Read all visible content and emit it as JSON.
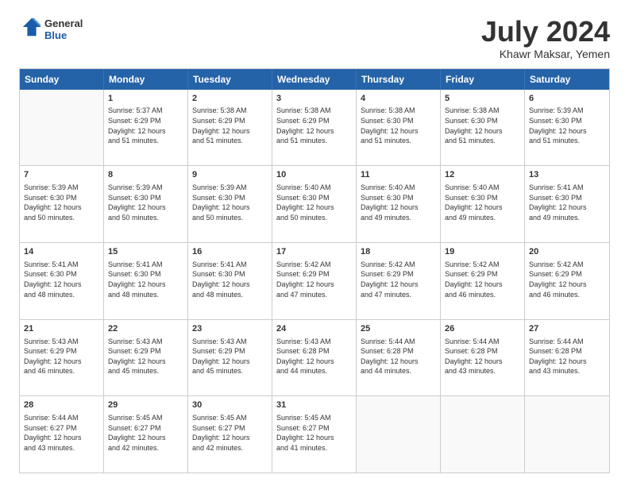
{
  "header": {
    "logo_general": "General",
    "logo_blue": "Blue",
    "month_title": "July 2024",
    "subtitle": "Khawr Maksar, Yemen"
  },
  "weekdays": [
    "Sunday",
    "Monday",
    "Tuesday",
    "Wednesday",
    "Thursday",
    "Friday",
    "Saturday"
  ],
  "rows": [
    [
      {
        "day": "",
        "info": ""
      },
      {
        "day": "1",
        "info": "Sunrise: 5:37 AM\nSunset: 6:29 PM\nDaylight: 12 hours\nand 51 minutes."
      },
      {
        "day": "2",
        "info": "Sunrise: 5:38 AM\nSunset: 6:29 PM\nDaylight: 12 hours\nand 51 minutes."
      },
      {
        "day": "3",
        "info": "Sunrise: 5:38 AM\nSunset: 6:29 PM\nDaylight: 12 hours\nand 51 minutes."
      },
      {
        "day": "4",
        "info": "Sunrise: 5:38 AM\nSunset: 6:30 PM\nDaylight: 12 hours\nand 51 minutes."
      },
      {
        "day": "5",
        "info": "Sunrise: 5:38 AM\nSunset: 6:30 PM\nDaylight: 12 hours\nand 51 minutes."
      },
      {
        "day": "6",
        "info": "Sunrise: 5:39 AM\nSunset: 6:30 PM\nDaylight: 12 hours\nand 51 minutes."
      }
    ],
    [
      {
        "day": "7",
        "info": "Sunrise: 5:39 AM\nSunset: 6:30 PM\nDaylight: 12 hours\nand 50 minutes."
      },
      {
        "day": "8",
        "info": "Sunrise: 5:39 AM\nSunset: 6:30 PM\nDaylight: 12 hours\nand 50 minutes."
      },
      {
        "day": "9",
        "info": "Sunrise: 5:39 AM\nSunset: 6:30 PM\nDaylight: 12 hours\nand 50 minutes."
      },
      {
        "day": "10",
        "info": "Sunrise: 5:40 AM\nSunset: 6:30 PM\nDaylight: 12 hours\nand 50 minutes."
      },
      {
        "day": "11",
        "info": "Sunrise: 5:40 AM\nSunset: 6:30 PM\nDaylight: 12 hours\nand 49 minutes."
      },
      {
        "day": "12",
        "info": "Sunrise: 5:40 AM\nSunset: 6:30 PM\nDaylight: 12 hours\nand 49 minutes."
      },
      {
        "day": "13",
        "info": "Sunrise: 5:41 AM\nSunset: 6:30 PM\nDaylight: 12 hours\nand 49 minutes."
      }
    ],
    [
      {
        "day": "14",
        "info": "Sunrise: 5:41 AM\nSunset: 6:30 PM\nDaylight: 12 hours\nand 48 minutes."
      },
      {
        "day": "15",
        "info": "Sunrise: 5:41 AM\nSunset: 6:30 PM\nDaylight: 12 hours\nand 48 minutes."
      },
      {
        "day": "16",
        "info": "Sunrise: 5:41 AM\nSunset: 6:30 PM\nDaylight: 12 hours\nand 48 minutes."
      },
      {
        "day": "17",
        "info": "Sunrise: 5:42 AM\nSunset: 6:29 PM\nDaylight: 12 hours\nand 47 minutes."
      },
      {
        "day": "18",
        "info": "Sunrise: 5:42 AM\nSunset: 6:29 PM\nDaylight: 12 hours\nand 47 minutes."
      },
      {
        "day": "19",
        "info": "Sunrise: 5:42 AM\nSunset: 6:29 PM\nDaylight: 12 hours\nand 46 minutes."
      },
      {
        "day": "20",
        "info": "Sunrise: 5:42 AM\nSunset: 6:29 PM\nDaylight: 12 hours\nand 46 minutes."
      }
    ],
    [
      {
        "day": "21",
        "info": "Sunrise: 5:43 AM\nSunset: 6:29 PM\nDaylight: 12 hours\nand 46 minutes."
      },
      {
        "day": "22",
        "info": "Sunrise: 5:43 AM\nSunset: 6:29 PM\nDaylight: 12 hours\nand 45 minutes."
      },
      {
        "day": "23",
        "info": "Sunrise: 5:43 AM\nSunset: 6:29 PM\nDaylight: 12 hours\nand 45 minutes."
      },
      {
        "day": "24",
        "info": "Sunrise: 5:43 AM\nSunset: 6:28 PM\nDaylight: 12 hours\nand 44 minutes."
      },
      {
        "day": "25",
        "info": "Sunrise: 5:44 AM\nSunset: 6:28 PM\nDaylight: 12 hours\nand 44 minutes."
      },
      {
        "day": "26",
        "info": "Sunrise: 5:44 AM\nSunset: 6:28 PM\nDaylight: 12 hours\nand 43 minutes."
      },
      {
        "day": "27",
        "info": "Sunrise: 5:44 AM\nSunset: 6:28 PM\nDaylight: 12 hours\nand 43 minutes."
      }
    ],
    [
      {
        "day": "28",
        "info": "Sunrise: 5:44 AM\nSunset: 6:27 PM\nDaylight: 12 hours\nand 43 minutes."
      },
      {
        "day": "29",
        "info": "Sunrise: 5:45 AM\nSunset: 6:27 PM\nDaylight: 12 hours\nand 42 minutes."
      },
      {
        "day": "30",
        "info": "Sunrise: 5:45 AM\nSunset: 6:27 PM\nDaylight: 12 hours\nand 42 minutes."
      },
      {
        "day": "31",
        "info": "Sunrise: 5:45 AM\nSunset: 6:27 PM\nDaylight: 12 hours\nand 41 minutes."
      },
      {
        "day": "",
        "info": ""
      },
      {
        "day": "",
        "info": ""
      },
      {
        "day": "",
        "info": ""
      }
    ]
  ]
}
